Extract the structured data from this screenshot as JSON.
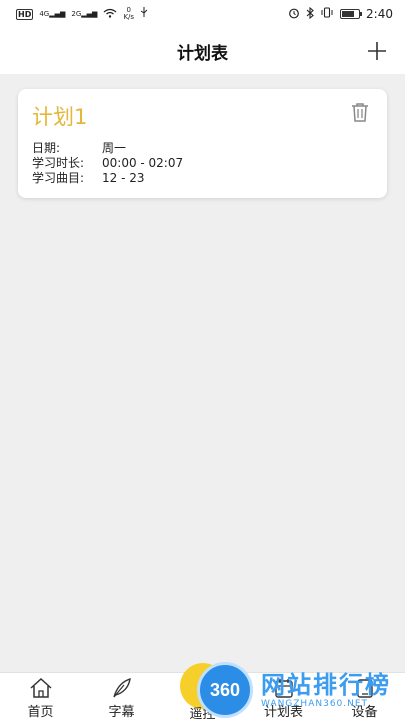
{
  "status_bar": {
    "left_badge": "HD",
    "net1": "4G",
    "net2": "2G",
    "speed_value": "0",
    "speed_unit": "K/s",
    "time": "2:40",
    "battery_level": 0.75
  },
  "header": {
    "title": "计划表"
  },
  "plan": {
    "name": "计划1",
    "rows": [
      {
        "label": "日期:",
        "value": "周一"
      },
      {
        "label": "学习时长:",
        "value": "00:00 - 02:07"
      },
      {
        "label": "学习曲目:",
        "value": "12 - 23"
      }
    ]
  },
  "nav": {
    "items": [
      {
        "label": "首页",
        "icon": "home-icon"
      },
      {
        "label": "字幕",
        "icon": "feather-icon"
      },
      {
        "label": "遥控",
        "icon": "remote-icon"
      },
      {
        "label": "计划表",
        "icon": "plan-icon"
      },
      {
        "label": "设备",
        "icon": "device-icon"
      }
    ]
  },
  "watermark": {
    "logo": "360",
    "title": "网站排行榜",
    "sub": "WANGZHAN360.NET"
  },
  "colors": {
    "accent": "#e4b73a",
    "remote_bubble": "#f7cf2b",
    "background": "#efefef"
  }
}
